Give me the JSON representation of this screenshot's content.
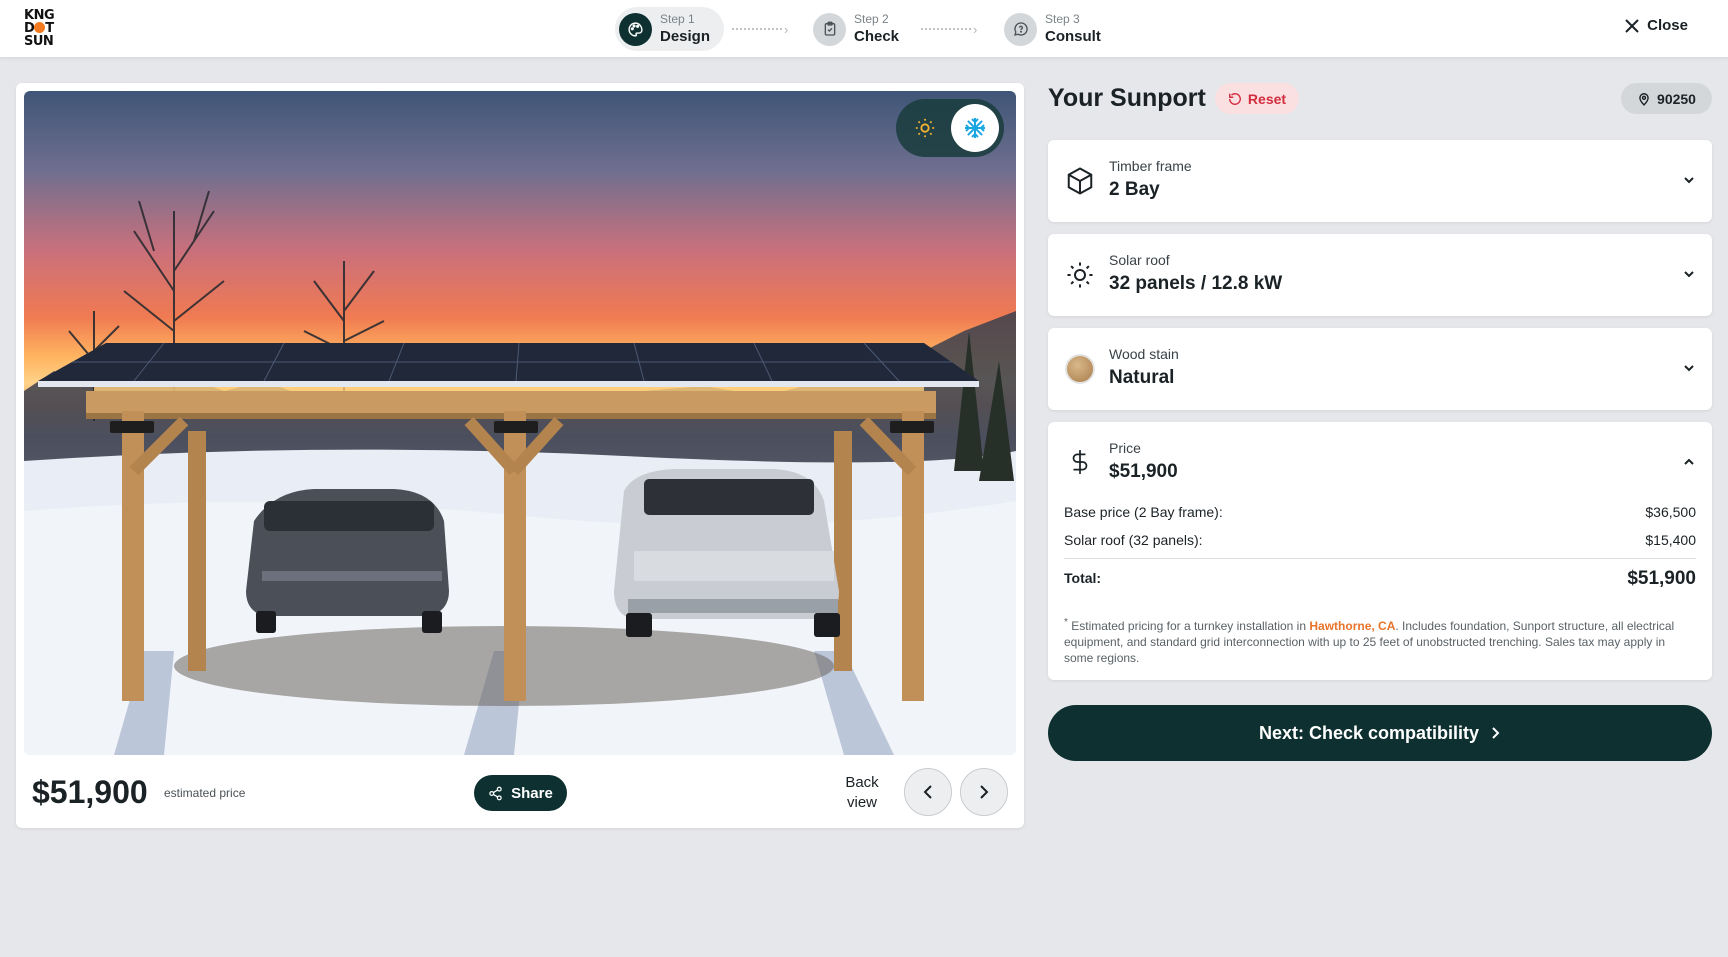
{
  "header": {
    "logo_text": "KING DOT SUN",
    "steps": [
      {
        "num": "Step 1",
        "name": "Design",
        "icon": "palette-icon",
        "active": true
      },
      {
        "num": "Step 2",
        "name": "Check",
        "icon": "clipboard-check-icon",
        "active": false
      },
      {
        "num": "Step 3",
        "name": "Consult",
        "icon": "chat-bubble-icon",
        "active": false
      }
    ],
    "close_label": "Close"
  },
  "viewer": {
    "season_options": [
      "summer",
      "winter"
    ],
    "season_selected": "winter",
    "price": "$51,900",
    "price_caption": "estimated price",
    "share_label": "Share",
    "view_label_line1": "Back",
    "view_label_line2": "view"
  },
  "config": {
    "title": "Your Sunport",
    "reset_label": "Reset",
    "zip": "90250",
    "options": [
      {
        "label": "Timber frame",
        "value": "2 Bay",
        "icon": "cube-icon"
      },
      {
        "label": "Solar roof",
        "value": "32 panels / 12.8 kW",
        "icon": "sun-icon"
      },
      {
        "label": "Wood stain",
        "value": "Natural",
        "icon": "wood-swatch"
      }
    ],
    "price": {
      "label": "Price",
      "value": "$51,900",
      "rows": [
        {
          "label": "Base price (2 Bay frame):",
          "value": "$36,500"
        },
        {
          "label": "Solar roof (32 panels):",
          "value": "$15,400"
        }
      ],
      "total_label": "Total:",
      "total_value": "$51,900",
      "note_star": "*",
      "note_before": " Estimated pricing for a turnkey installation in ",
      "note_location": "Hawthorne, CA",
      "note_after": ". Includes foundation, Sunport structure, all electrical equipment, and standard grid interconnection with up to 25 feet of unobstructed trenching. Sales tax may apply in some regions."
    },
    "next_label": "Next: Check compatibility"
  },
  "colors": {
    "primary": "#0e3030",
    "accent_orange": "#e8732a",
    "reset_red": "#d22d3d",
    "background": "#e6e7ea"
  }
}
